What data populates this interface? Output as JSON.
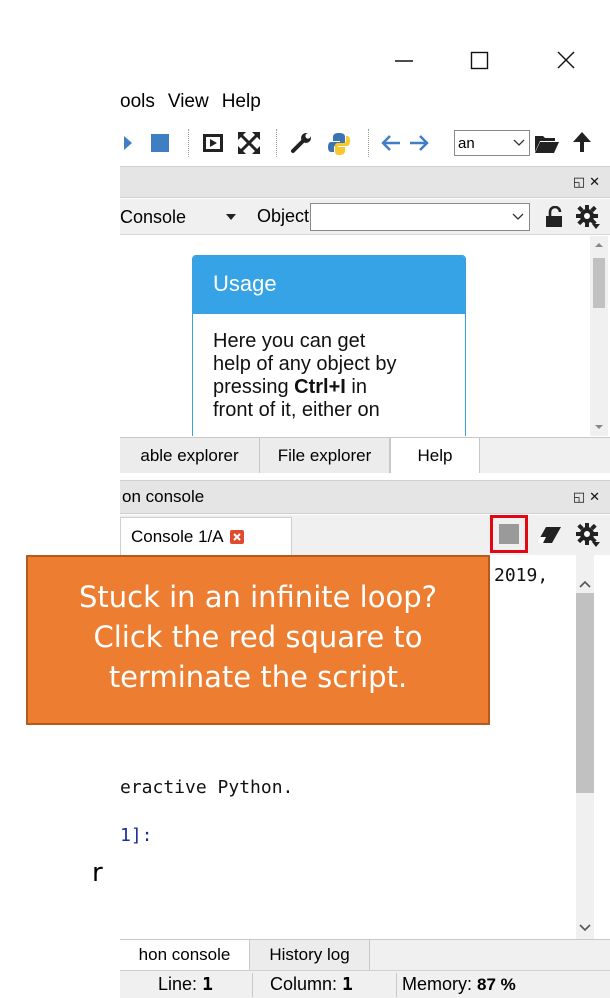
{
  "menu": [
    "ools",
    "View",
    "Help"
  ],
  "toolbar": {
    "working_dir_value": "an"
  },
  "help_pane": {
    "source_value": "Console",
    "object_label": "Object",
    "object_value": "",
    "usage_title": "Usage",
    "usage_text_1": "Here you can get",
    "usage_text_2": "help of any object by",
    "usage_text_3_pre": "pressing ",
    "usage_text_3_bold": "Ctrl+I",
    "usage_text_3_post": " in",
    "usage_text_4": "front of it, either on"
  },
  "top_tabs": [
    "able explorer",
    "File explorer",
    "Help"
  ],
  "console_pane": {
    "title": "on console",
    "tab_label": "Console 1/A",
    "lines": {
      "l1": "2019,",
      "l2": "eractive Python.",
      "l3": "1]:"
    }
  },
  "bottom_tabs": [
    "hon console",
    "History log"
  ],
  "callout": {
    "line1": "Stuck in an infinite loop?",
    "line2": "Click the red square to",
    "line3": "terminate the script."
  },
  "stray_char": "r",
  "status": {
    "line_label": "Line:",
    "line_value": "1",
    "column_label": "Column:",
    "column_value": "1",
    "memory_label": "Memory:",
    "memory_value": "87 %"
  },
  "colors": {
    "callout_bg": "#ed7d31",
    "usage_header": "#35a3e6",
    "highlight_box": "#e30613",
    "stop_square": "#3f7ec5"
  }
}
